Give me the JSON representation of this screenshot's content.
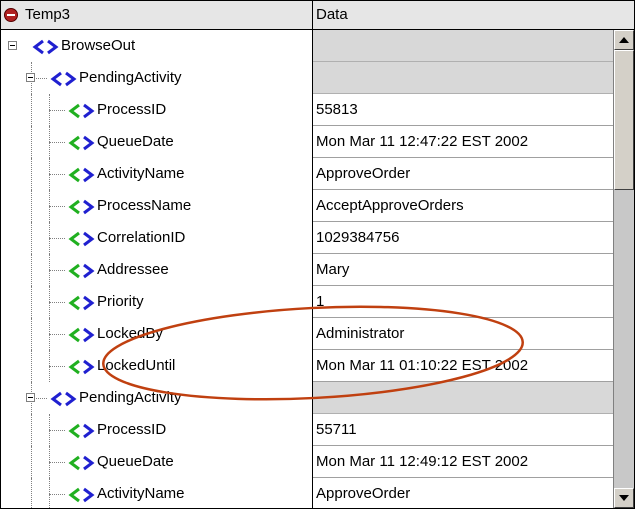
{
  "header": {
    "name_column": "Temp3",
    "data_column": "Data"
  },
  "colors": {
    "xml_icon_blue": "#2020d0",
    "xml_icon_green": "#20b020",
    "annotation_ellipse": "#c04010",
    "group_row_bg": "#d8d8d8"
  },
  "rows": [
    {
      "label": "BrowseOut",
      "value": "",
      "kind": "group",
      "level": 0,
      "expandable": true
    },
    {
      "label": "PendingActivity",
      "value": "",
      "kind": "group",
      "level": 1,
      "expandable": true
    },
    {
      "label": "ProcessID",
      "value": "55813",
      "kind": "leaf",
      "level": 2
    },
    {
      "label": "QueueDate",
      "value": "Mon Mar 11 12:47:22 EST 2002",
      "kind": "leaf",
      "level": 2
    },
    {
      "label": "ActivityName",
      "value": "ApproveOrder",
      "kind": "leaf",
      "level": 2
    },
    {
      "label": "ProcessName",
      "value": "AcceptApproveOrders",
      "kind": "leaf",
      "level": 2
    },
    {
      "label": "CorrelationID",
      "value": "1029384756",
      "kind": "leaf",
      "level": 2
    },
    {
      "label": "Addressee",
      "value": "Mary",
      "kind": "leaf",
      "level": 2
    },
    {
      "label": "Priority",
      "value": "1",
      "kind": "leaf",
      "level": 2
    },
    {
      "label": "LockedBy",
      "value": "Administrator",
      "kind": "leaf",
      "level": 2
    },
    {
      "label": "LockedUntil",
      "value": "Mon Mar 11 01:10:22 EST 2002",
      "kind": "leaf",
      "level": 2
    },
    {
      "label": "PendingActivity",
      "value": "",
      "kind": "group",
      "level": 1,
      "expandable": true
    },
    {
      "label": "ProcessID",
      "value": "55711",
      "kind": "leaf",
      "level": 2
    },
    {
      "label": "QueueDate",
      "value": "Mon Mar 11 12:49:12 EST 2002",
      "kind": "leaf",
      "level": 2
    },
    {
      "label": "ActivityName",
      "value": "ApproveOrder",
      "kind": "leaf",
      "level": 2
    }
  ]
}
